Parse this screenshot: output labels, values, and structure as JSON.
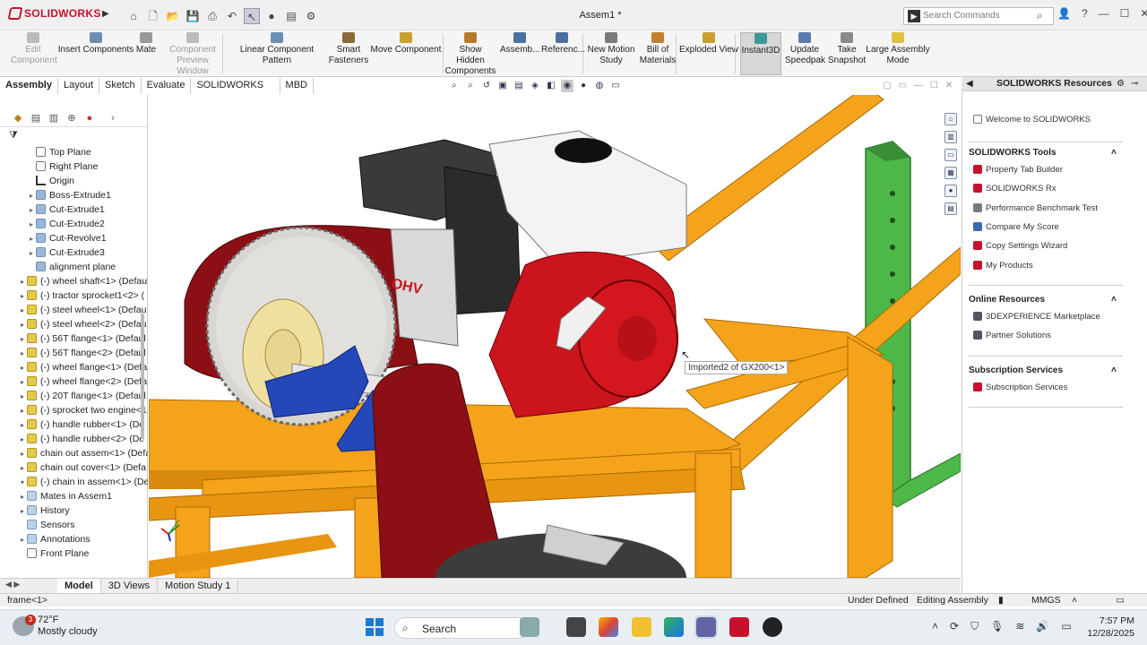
{
  "app": {
    "brand": "SOLIDWORKS",
    "document_title": "Assem1 *"
  },
  "search": {
    "placeholder": "Search Commands"
  },
  "ribbon": [
    {
      "key": "edit",
      "label": "Edit Component",
      "disabled": true
    },
    {
      "key": "insert",
      "label": "Insert Components",
      "disabled": false
    },
    {
      "key": "mate",
      "label": "Mate",
      "disabled": false
    },
    {
      "key": "preview",
      "label": "Component Preview Window",
      "disabled": true
    },
    {
      "key": "linear",
      "label": "Linear Component Pattern",
      "disabled": false
    },
    {
      "key": "smart",
      "label": "Smart Fasteners",
      "disabled": false
    },
    {
      "key": "move",
      "label": "Move Component",
      "disabled": false
    },
    {
      "key": "hidden",
      "label": "Show Hidden Components",
      "disabled": false
    },
    {
      "key": "assemb",
      "label": "Assemb...",
      "disabled": false
    },
    {
      "key": "ref",
      "label": "Referenc...",
      "disabled": false
    },
    {
      "key": "motion",
      "label": "New Motion Study",
      "disabled": false
    },
    {
      "key": "bom",
      "label": "Bill of Materials",
      "disabled": false
    },
    {
      "key": "exploded",
      "label": "Exploded View",
      "disabled": false
    },
    {
      "key": "instant",
      "label": "Instant3D",
      "disabled": false,
      "active": true
    },
    {
      "key": "speedpak",
      "label": "Update Speedpak",
      "disabled": false
    },
    {
      "key": "snapshot",
      "label": "Take Snapshot",
      "disabled": false
    },
    {
      "key": "large",
      "label": "Large Assembly Mode",
      "disabled": false
    }
  ],
  "command_tabs": [
    "Assembly",
    "Layout",
    "Sketch",
    "Evaluate",
    "SOLIDWORKS Add-Ins",
    "MBD"
  ],
  "tree": [
    {
      "label": "Top Plane",
      "icon": "plane",
      "expand": ""
    },
    {
      "label": "Right Plane",
      "icon": "plane",
      "expand": ""
    },
    {
      "label": "Origin",
      "icon": "origin",
      "expand": ""
    },
    {
      "label": "Boss-Extrude1",
      "icon": "feat",
      "expand": "▸"
    },
    {
      "label": "Cut-Extrude1",
      "icon": "feat",
      "expand": "▸"
    },
    {
      "label": "Cut-Extrude2",
      "icon": "feat",
      "expand": "▸"
    },
    {
      "label": "Cut-Revolve1",
      "icon": "feat",
      "expand": "▸"
    },
    {
      "label": "Cut-Extrude3",
      "icon": "feat",
      "expand": "▸"
    },
    {
      "label": "alignment plane",
      "icon": "feat",
      "expand": ""
    },
    {
      "label": "(-) wheel shaft<1> (Defau",
      "icon": "part",
      "expand": "▸"
    },
    {
      "label": "(-) tractor sprocket1<2> (",
      "icon": "part",
      "expand": "▸"
    },
    {
      "label": "(-) steel wheel<1> (Defau",
      "icon": "part",
      "expand": "▸"
    },
    {
      "label": "(-) steel wheel<2> (Defau",
      "icon": "part",
      "expand": "▸"
    },
    {
      "label": "(-) 56T flange<1> (Defaul",
      "icon": "part",
      "expand": "▸"
    },
    {
      "label": "(-) 56T flange<2> (Defaul",
      "icon": "part",
      "expand": "▸"
    },
    {
      "label": "(-) wheel flange<1> (Defa",
      "icon": "part",
      "expand": "▸"
    },
    {
      "label": "(-) wheel flange<2> (Defa",
      "icon": "part",
      "expand": "▸"
    },
    {
      "label": "(-) 20T flange<1> (Defaul",
      "icon": "part",
      "expand": "▸"
    },
    {
      "label": "(-) sprocket two engine<1",
      "icon": "part",
      "expand": "▸"
    },
    {
      "label": "(-) handle rubber<1> (De",
      "icon": "part",
      "expand": "▸"
    },
    {
      "label": "(-) handle rubber<2> (De",
      "icon": "part",
      "expand": "▸"
    },
    {
      "label": "chain out assem<1> (Defa",
      "icon": "part",
      "expand": "▸"
    },
    {
      "label": "chain out cover<1> (Defa",
      "icon": "part",
      "expand": "▸"
    },
    {
      "label": "(-) chain in assem<1> (De",
      "icon": "part",
      "expand": "▾"
    },
    {
      "label": "Mates in Assem1",
      "icon": "folder",
      "expand": "▸",
      "indent": true
    },
    {
      "label": "History",
      "icon": "folder",
      "expand": "▸",
      "indent": true
    },
    {
      "label": "Sensors",
      "icon": "folder",
      "expand": "",
      "indent": true
    },
    {
      "label": "Annotations",
      "icon": "folder",
      "expand": "▸",
      "indent": true
    },
    {
      "label": "Front Plane",
      "icon": "plane",
      "expand": "",
      "indent": true
    }
  ],
  "bottom_tabs": [
    "Model",
    "3D Views",
    "Motion Study 1"
  ],
  "status": {
    "selection": "frame<1>",
    "defined": "Under Defined",
    "mode": "Editing Assembly",
    "units": "MMGS"
  },
  "viewport": {
    "tooltip": "Imported2 of GX200<1>",
    "engine_brand": "OHV"
  },
  "task_pane": {
    "title": "SOLIDWORKS Resources",
    "welcome": "Welcome to SOLIDWORKS",
    "sections": [
      {
        "title": "SOLIDWORKS Tools",
        "items": [
          "Property Tab Builder",
          "SOLIDWORKS Rx",
          "Performance Benchmark Test",
          "Compare My Score",
          "Copy Settings Wizard",
          "My Products"
        ]
      },
      {
        "title": "Online Resources",
        "items": [
          "3DEXPERIENCE Marketplace",
          "Partner Solutions"
        ]
      },
      {
        "title": "Subscription Services",
        "items": [
          "Subscription Services"
        ]
      }
    ]
  },
  "taskbar": {
    "temp": "72°F",
    "condition": "Mostly cloudy",
    "badge": "3",
    "search": "Search",
    "time": "7:57 PM",
    "date": "12/28/2025"
  },
  "colors": {
    "frame": "#f5a31a",
    "engine_red": "#c8141c",
    "chain_case": "#8b0f14",
    "bearing_blue": "#1f3fa8",
    "green_post": "#3ea63a",
    "brand": "#c8102e"
  }
}
